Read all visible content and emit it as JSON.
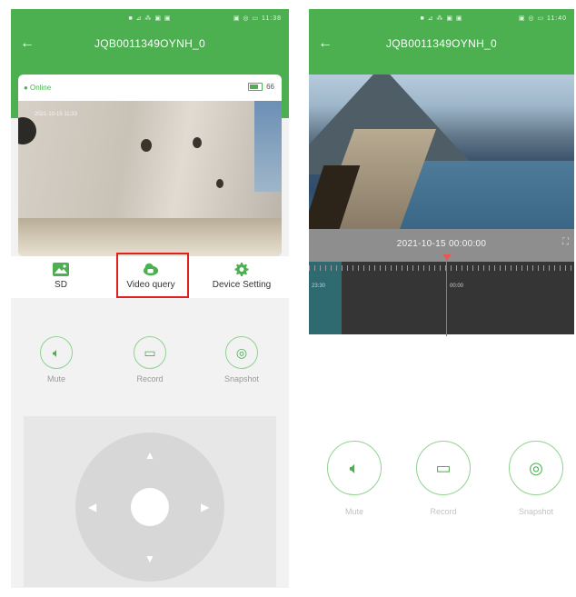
{
  "colors": {
    "accent": "#4caf50",
    "highlight": "#e02020"
  },
  "phone1": {
    "status_left": "■ ⊿ ⁂ ▣ ▣",
    "status_right": "▣ ◎ ▭ 11:38",
    "back_icon": "←",
    "title": "JQB0011349OYNH_0",
    "online": "● Online",
    "battery": "66",
    "cam_timestamp": "2021-10-15  11:33",
    "functions": [
      {
        "label": "SD",
        "icon": "image-icon"
      },
      {
        "label": "Video query",
        "icon": "video-cloud-icon"
      },
      {
        "label": "Device Setting",
        "icon": "gear-icon"
      }
    ],
    "actions": [
      {
        "label": "Mute",
        "icon": "speaker-icon",
        "glyph": "🔈︎"
      },
      {
        "label": "Record",
        "icon": "video-camera-icon",
        "glyph": "▭"
      },
      {
        "label": "Snapshot",
        "icon": "camera-icon",
        "glyph": "◎"
      }
    ],
    "pad_arrows": {
      "up": "▲",
      "down": "▼",
      "left": "◀",
      "right": "▶"
    }
  },
  "phone2": {
    "status_left": "■ ⊿ ⁂ ▣ ▣",
    "status_right": "▣ ◎ ▭ 11:40",
    "back_icon": "←",
    "title": "JQB0011349OYNH_0",
    "timestamp": "2021-10-15 00:00:00",
    "fullscreen_icon": "⛶",
    "tick_labels": [
      "23:30",
      "00:00"
    ],
    "actions": [
      {
        "label": "Mute",
        "glyph": "🔈︎"
      },
      {
        "label": "Record",
        "glyph": "▭"
      },
      {
        "label": "Snapshot",
        "glyph": "◎"
      }
    ]
  }
}
